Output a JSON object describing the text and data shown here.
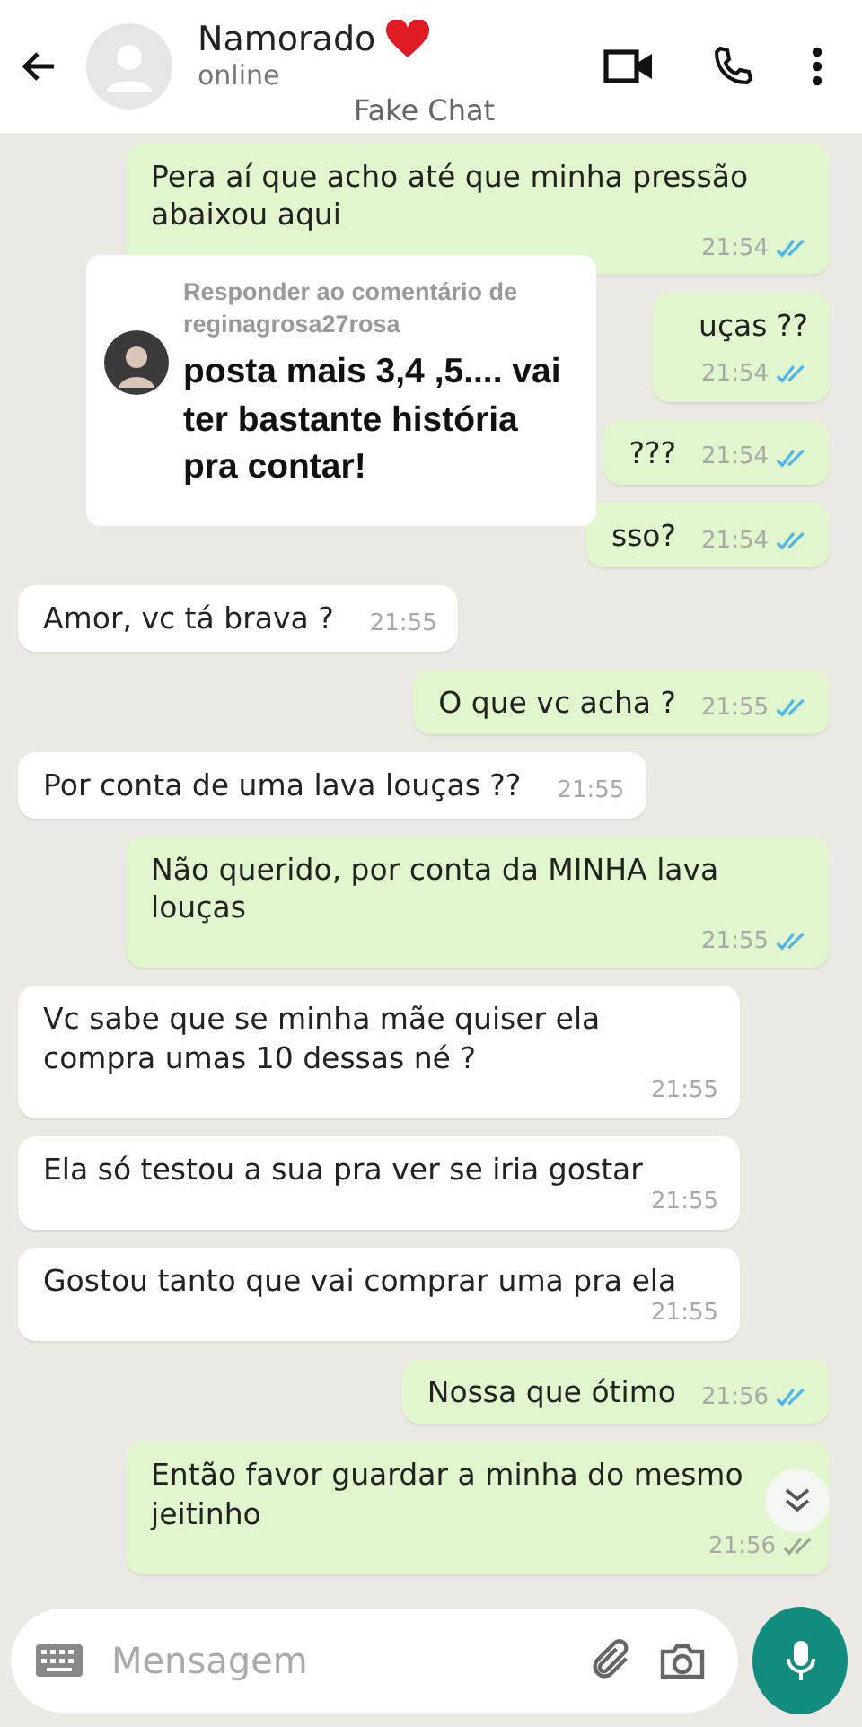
{
  "header": {
    "title": "Namorado",
    "status": "online",
    "subtitle": "Fake Chat"
  },
  "messages": [
    {
      "kind": "out",
      "text": "Pera aí que acho até que minha pressão abaixou aqui",
      "time": "21:54",
      "read": true
    },
    {
      "kind": "out",
      "text": "uças ??",
      "time": "21:54",
      "read": true,
      "tall": true
    },
    {
      "kind": "out",
      "text": "???",
      "time": "21:54",
      "read": true
    },
    {
      "kind": "out",
      "text": "sso?",
      "time": "21:54",
      "read": true
    },
    {
      "kind": "in",
      "text": "Amor, vc tá brava ?",
      "time": "21:55"
    },
    {
      "kind": "out",
      "text": "O que vc acha ?",
      "time": "21:55",
      "read": true
    },
    {
      "kind": "in",
      "text": "Por conta de uma lava louças ??",
      "time": "21:55"
    },
    {
      "kind": "out",
      "text": "Não querido, por conta da MINHA lava louças",
      "time": "21:55",
      "read": true
    },
    {
      "kind": "in",
      "text": "Vc sabe que se minha mãe quiser ela compra umas 10 dessas né ?",
      "time": "21:55"
    },
    {
      "kind": "in",
      "text": "Ela só testou a sua pra ver se iria gostar",
      "time": "21:55"
    },
    {
      "kind": "in",
      "text": "Gostou tanto que vai comprar uma pra ela",
      "time": "21:55"
    },
    {
      "kind": "out",
      "text": "Nossa que ótimo",
      "time": "21:56",
      "read": true
    },
    {
      "kind": "out",
      "text": "Então favor guardar a minha do mesmo jeitinho",
      "time": "21:56",
      "read": false
    }
  ],
  "reply_card": {
    "heading": "Responder ao comentário de reginagrosa27rosa",
    "comment": "posta mais 3,4 ,5.... vai ter bastante história pra contar!"
  },
  "composer": {
    "placeholder": "Mensagem"
  }
}
